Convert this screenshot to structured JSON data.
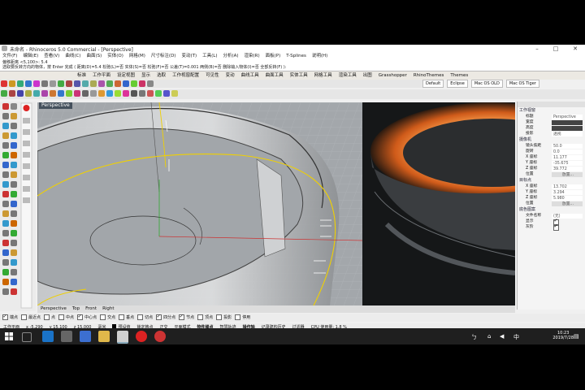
{
  "window": {
    "title": "未命名 - Rhinoceros 5.0 Commercial - [Perspective]"
  },
  "menu": [
    "文件(F)",
    "编辑(E)",
    "查看(V)",
    "曲线(C)",
    "曲面(S)",
    "实体(O)",
    "网格(M)",
    "尺寸标注(D)",
    "变动(T)",
    "工具(L)",
    "分析(A)",
    "渲染(R)",
    "面板(P)",
    "T-Splines",
    "说明(H)"
  ],
  "command_history": [
    "偏移距离 <5,100>: 5.4",
    "选取要反转方向的物体，按 Enter 完成 ( 距离(D)=5.4 松弛(L)=否 实体(S)=否 松弛(F)=否 公差(T)=0.001 两侧(B)=否 删除输入物体(I)=否 全部反转(F) ):"
  ],
  "tabs": [
    "标准",
    "工作平面",
    "设定视图",
    "显示",
    "选取",
    "工作视窗配置",
    "可见性",
    "变动",
    "曲线工具",
    "曲面工具",
    "实体工具",
    "网格工具",
    "渲染工具",
    "出图",
    "Grasshopper",
    "RhinoThemes",
    "Themes"
  ],
  "themes": [
    "Default",
    "Eclipse",
    "Mac OS OLD",
    "Mac OS Tiger"
  ],
  "viewport": {
    "label": "Perspective"
  },
  "viewport_tabs": [
    "Perspective",
    "Top",
    "Front",
    "Right"
  ],
  "properties": {
    "sections": [
      {
        "heading": "工作视窗",
        "rows": [
          {
            "k": "标题",
            "v": "Perspective"
          },
          {
            "k": "宽度",
            "v": ""
          },
          {
            "k": "高度",
            "v": ""
          },
          {
            "k": "投影",
            "v": "透视"
          }
        ]
      },
      {
        "heading": "摄像机",
        "rows": [
          {
            "k": "镜头焦距",
            "v": "50.0"
          },
          {
            "k": "旋转",
            "v": "0.0"
          },
          {
            "k": "X 座标",
            "v": "11.177"
          },
          {
            "k": "Y 座标",
            "v": "-35.675"
          },
          {
            "k": "Z 座标",
            "v": "39.772"
          },
          {
            "k": "位置",
            "v": "放置..."
          }
        ]
      },
      {
        "heading": "目标点",
        "rows": [
          {
            "k": "X 座标",
            "v": "13.702"
          },
          {
            "k": "Y 座标",
            "v": "3.294"
          },
          {
            "k": "Z 座标",
            "v": "5.980"
          },
          {
            "k": "位置",
            "v": "放置..."
          }
        ]
      },
      {
        "heading": "底色图案",
        "rows": [
          {
            "k": "文件名称",
            "v": "(无)"
          },
          {
            "k": "显示",
            "v": ""
          },
          {
            "k": "灰阶",
            "v": ""
          }
        ]
      }
    ]
  },
  "osnaps": [
    {
      "label": "端点",
      "on": true
    },
    {
      "label": "最近点",
      "on": false
    },
    {
      "label": "点",
      "on": false
    },
    {
      "label": "中点",
      "on": false
    },
    {
      "label": "中心点",
      "on": true
    },
    {
      "label": "交点",
      "on": false
    },
    {
      "label": "垂点",
      "on": false
    },
    {
      "label": "切点",
      "on": false
    },
    {
      "label": "四分点",
      "on": true
    },
    {
      "label": "节点",
      "on": true
    },
    {
      "label": "顶点",
      "on": false
    },
    {
      "label": "投影",
      "on": false
    },
    {
      "label": "停用",
      "on": false
    }
  ],
  "status": {
    "cplane": "工作平面",
    "x": "x -5.290",
    "y": "y 15.100",
    "z": "z 15.000",
    "units": "毫米",
    "layer": "预设值",
    "toggles": [
      "锁定格点",
      "正交",
      "平面模式",
      "物件锁点",
      "智慧轨迹",
      "操作轴",
      "记录建构历史",
      "过滤器"
    ],
    "cpu": "CPU 使用量: 1.8 %"
  },
  "clock": {
    "time": "10:23",
    "date": "2019/7/28"
  },
  "colors": {
    "accent": "#f0b000",
    "viewport": "#9ea3a8",
    "taskbar": "#1f1f1f"
  }
}
